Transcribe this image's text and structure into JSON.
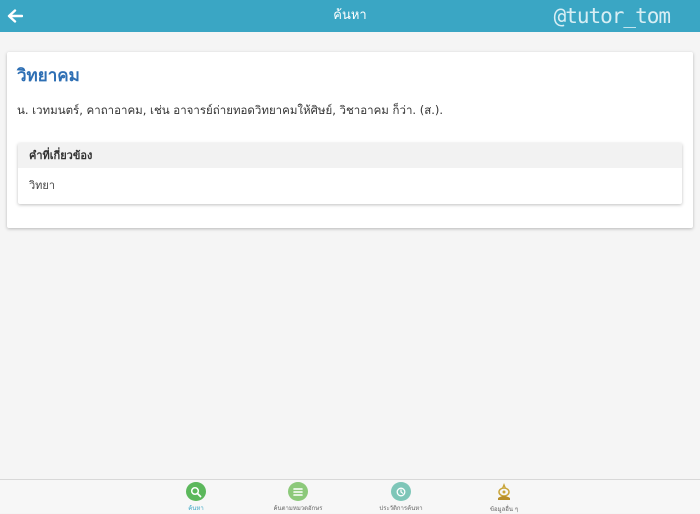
{
  "header": {
    "title": "ค้นหา",
    "watermark": "@tutor_tom"
  },
  "entry": {
    "word": "วิทยาคม",
    "definition": "น. เวทมนตร์, คาถาอาคม, เช่น อาจารย์ถ่ายทอดวิทยาคมให้ศิษย์, วิชาอาคม ก็ว่า. (ส.)."
  },
  "related": {
    "header": "คำที่เกี่ยวข้อง",
    "items": [
      "วิทยา"
    ]
  },
  "bottom_nav": {
    "items": [
      {
        "label": "ค้นหา",
        "icon": "search-icon",
        "color": "#5cb85c",
        "active": true
      },
      {
        "label": "ค้นตามหมวดอักษร",
        "icon": "list-icon",
        "color": "#8cc97a",
        "active": false
      },
      {
        "label": "ประวัติการค้นหา",
        "icon": "history-icon",
        "color": "#7ec6b8",
        "active": false
      },
      {
        "label": "ข้อมูลอื่น ๆ",
        "icon": "emblem-icon",
        "color": "#c9a53a",
        "active": false
      }
    ]
  },
  "colors": {
    "header_bg": "#3aa6c4",
    "title_blue": "#2e6fb4"
  }
}
